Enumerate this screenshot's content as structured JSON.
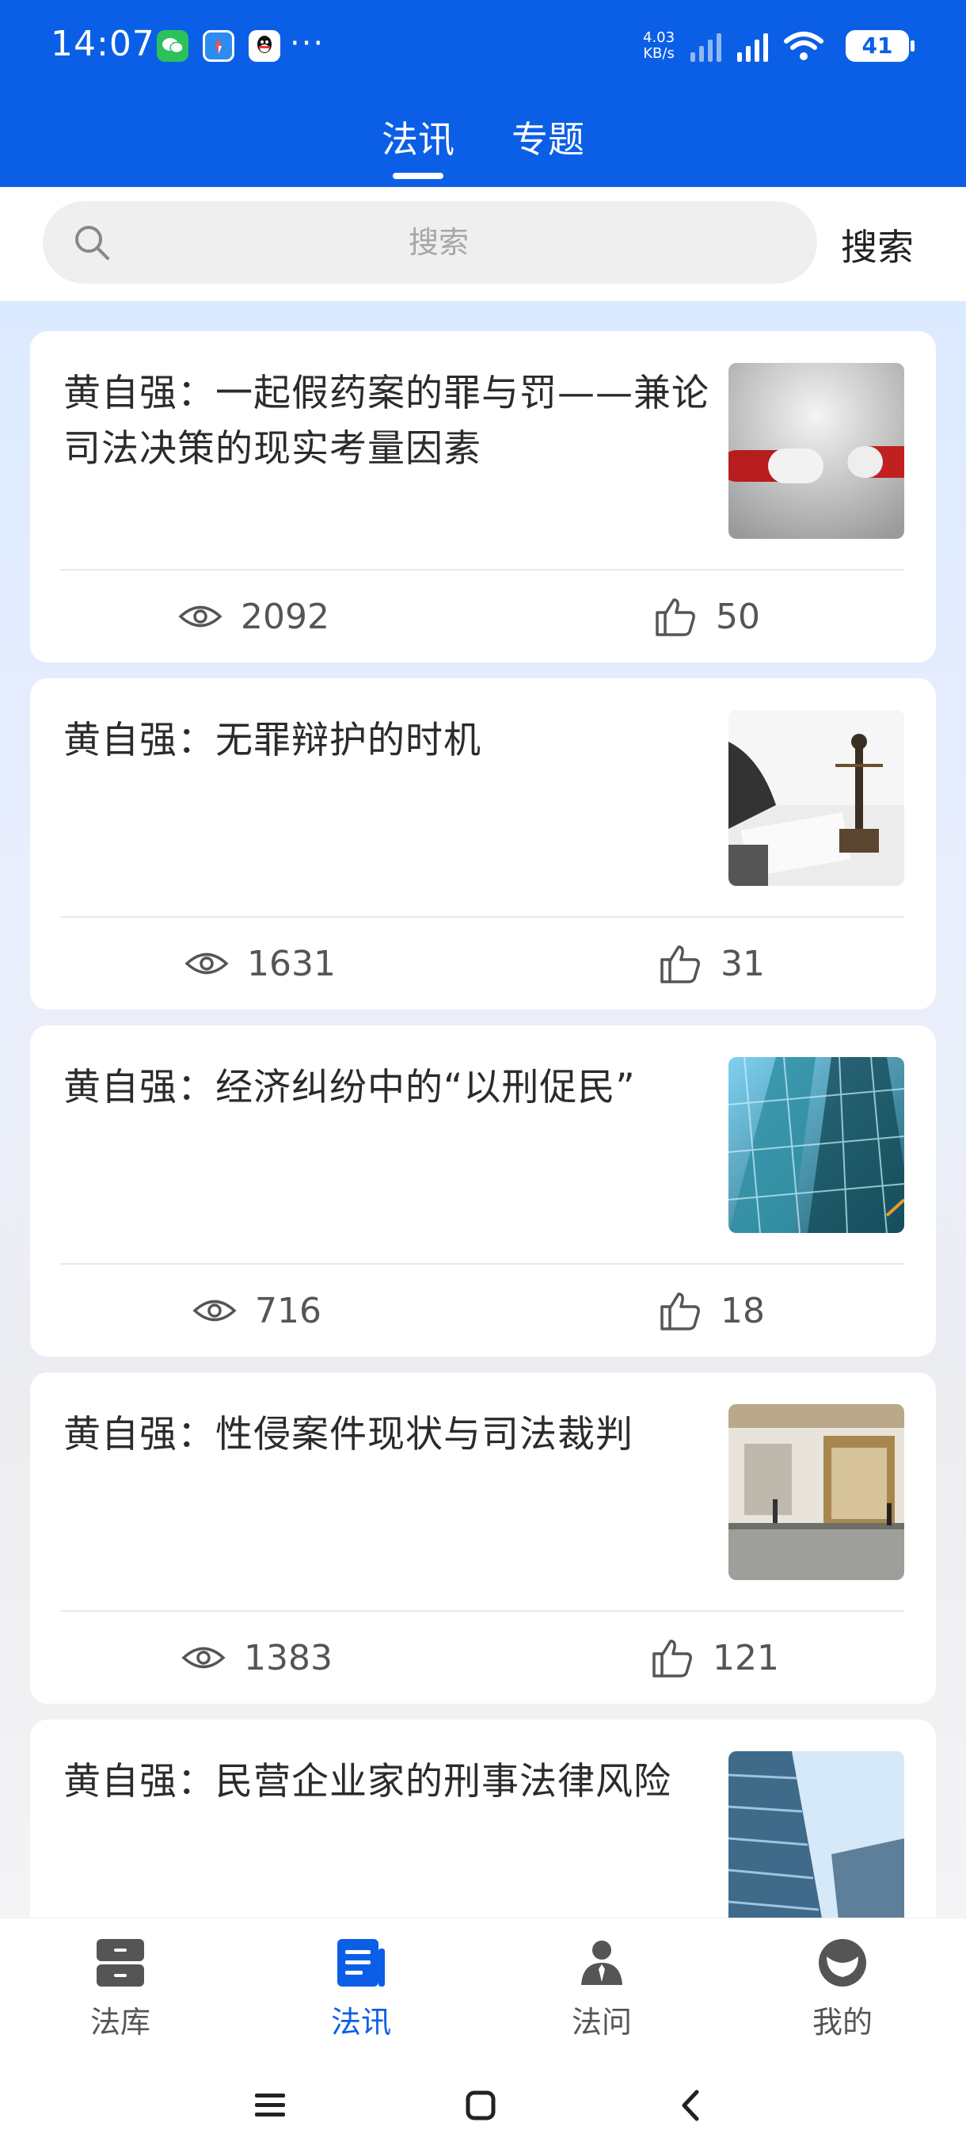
{
  "status_bar": {
    "time": "14:07",
    "more": "···",
    "net_speed_value": "4.03",
    "net_speed_unit": "KB/s",
    "battery": "41"
  },
  "top_tabs": [
    {
      "label": "法讯",
      "active": true
    },
    {
      "label": "专题",
      "active": false
    }
  ],
  "search": {
    "placeholder": "搜索",
    "button_label": "搜索"
  },
  "articles": [
    {
      "title": "黄自强：一起假药案的罪与罚——兼论司法决策的现实考量因素",
      "views": "2092",
      "likes": "50",
      "image": "pills"
    },
    {
      "title": "黄自强：无罪辩护的时机",
      "views": "1631",
      "likes": "31",
      "image": "justice-statue"
    },
    {
      "title": "黄自强：经济纠纷中的“以刑促民”",
      "views": "716",
      "likes": "18",
      "image": "glass-building"
    },
    {
      "title": "黄自强：性侵案件现状与司法裁判",
      "views": "1383",
      "likes": "121",
      "image": "street"
    },
    {
      "title": "黄自强：民营企业家的刑事法律风险",
      "views": "",
      "likes": "",
      "image": "skyscraper"
    }
  ],
  "bottom_nav": [
    {
      "label": "法库",
      "icon": "cabinet-icon",
      "active": false
    },
    {
      "label": "法讯",
      "icon": "news-icon",
      "active": true
    },
    {
      "label": "法问",
      "icon": "lawyer-icon",
      "active": false
    },
    {
      "label": "我的",
      "icon": "profile-icon",
      "active": false
    }
  ],
  "colors": {
    "brand_blue": "#0b5fe6",
    "text_dark": "#2b2b2b",
    "text_gray": "#555555"
  }
}
